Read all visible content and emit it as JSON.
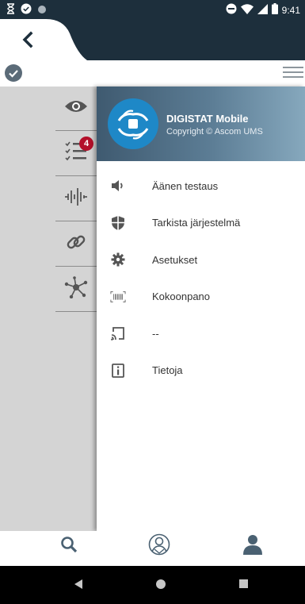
{
  "status_bar": {
    "time": "9:41",
    "icons": [
      "hourglass-icon",
      "check-circle-icon",
      "dot-icon",
      "do-not-disturb-icon",
      "wifi-icon",
      "signal-icon",
      "battery-icon"
    ]
  },
  "header": {
    "back_icon": "chevron-left-icon"
  },
  "subbar": {
    "left_icon": "check-circle-icon",
    "right_icon": "hamburger-menu-icon"
  },
  "rail": {
    "items": [
      {
        "icon": "eye-icon"
      },
      {
        "icon": "checklist-icon",
        "badge": "4"
      },
      {
        "icon": "waveform-icon"
      },
      {
        "icon": "link-icon"
      },
      {
        "icon": "network-icon"
      }
    ]
  },
  "drawer": {
    "title": "DIGISTAT Mobile",
    "subtitle": "Copyright © Ascom UMS",
    "logo_icon": "digistat-logo-icon",
    "items": [
      {
        "icon": "speaker-icon",
        "label": "Äänen testaus"
      },
      {
        "icon": "shield-icon",
        "label": "Tarkista järjestelmä"
      },
      {
        "icon": "gear-icon",
        "label": "Asetukset"
      },
      {
        "icon": "barcode-icon",
        "label": "Kokoonpano"
      },
      {
        "icon": "cast-icon",
        "label": "--"
      },
      {
        "icon": "info-icon",
        "label": "Tietoja"
      }
    ]
  },
  "bottom_nav": {
    "items": [
      {
        "icon": "search-icon"
      },
      {
        "icon": "patient-icon"
      },
      {
        "icon": "user-icon"
      }
    ]
  },
  "system_nav": {
    "items": [
      {
        "icon": "back-triangle-icon"
      },
      {
        "icon": "home-circle-icon"
      },
      {
        "icon": "recents-square-icon"
      }
    ]
  },
  "colors": {
    "header_dark": "#1d2f3c",
    "rail_gray": "#d4d4d4",
    "badge_red": "#b3102a",
    "logo_blue": "#1e88c7",
    "icon_gray": "#666666"
  }
}
